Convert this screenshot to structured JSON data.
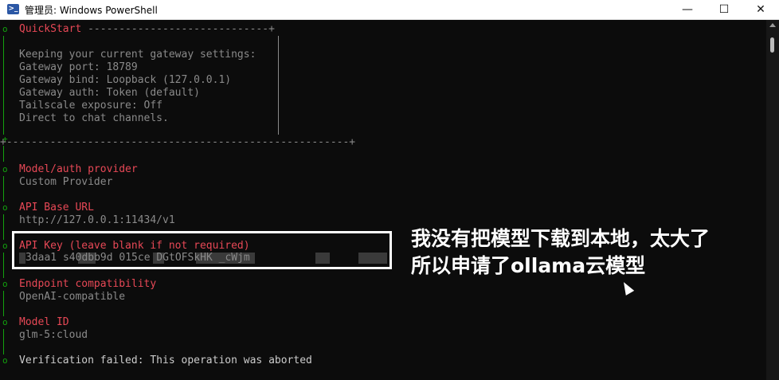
{
  "window": {
    "title": "管理员: Windows PowerShell",
    "icon": "powershell-icon",
    "minimize": "—",
    "maximize": "☐",
    "close": "✕"
  },
  "terminal": {
    "quickstart_header": "QuickStart ",
    "quickstart_rule": "-----------------------------+",
    "box_lines": [
      "Keeping your current gateway settings:",
      "Gateway port: 18789",
      "Gateway bind: Loopback (127.0.0.1)",
      "Gateway auth: Token (default)",
      "Tailscale exposure: Off",
      "Direct to chat channels."
    ],
    "box_bottom": "+-------------------------------------------------------+",
    "sections": [
      {
        "label": "Model/auth provider",
        "value": "Custom Provider"
      },
      {
        "label": "API Base URL",
        "value": "http://127.0.0.1:11434/v1"
      },
      {
        "label": "API Key (leave blank if not required)",
        "value": "3daa1 s40dbb9d 015ce DGtOFSkHK _cWjm"
      },
      {
        "label": "Endpoint compatibility",
        "value": "OpenAI-compatible"
      },
      {
        "label": "Model ID",
        "value": "glm-5:cloud"
      }
    ],
    "status": "Verification failed: This operation was aborted"
  },
  "annotation": {
    "line1": "我没有把模型下载到本地，太大了",
    "line2": "所以申请了ollama云模型"
  },
  "colors": {
    "background": "#0c0c0c",
    "label": "#e74856",
    "text": "#8a8a8a",
    "gutter": "#13a10e",
    "highlight": "#ffffff"
  }
}
